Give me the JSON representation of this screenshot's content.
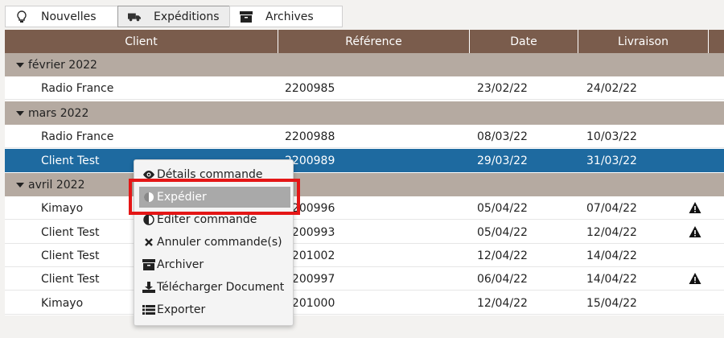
{
  "tabs": [
    {
      "label": "Nouvelles",
      "icon": "lightbulb-icon"
    },
    {
      "label": "Expéditions",
      "icon": "truck-icon",
      "active": true
    },
    {
      "label": "Archives",
      "icon": "archive-box-icon"
    }
  ],
  "table": {
    "columns": [
      "Client",
      "Référence",
      "Date",
      "Livraison",
      ""
    ],
    "groups": [
      {
        "label": "février 2022",
        "rows": [
          {
            "client": "Radio France",
            "ref": "2200985",
            "date": "23/02/22",
            "livraison": "24/02/22",
            "warning": false
          }
        ]
      },
      {
        "label": "mars 2022",
        "rows": [
          {
            "client": "Radio France",
            "ref": "2200988",
            "date": "08/03/22",
            "livraison": "10/03/22",
            "warning": false
          },
          {
            "client": "Client Test",
            "ref": "2200989",
            "date": "29/03/22",
            "livraison": "31/03/22",
            "warning": false,
            "selected": true
          }
        ]
      },
      {
        "label": "avril 2022",
        "rows": [
          {
            "client": "Kimayo",
            "ref": "2200996",
            "date": "05/04/22",
            "livraison": "07/04/22",
            "warning": true
          },
          {
            "client": "Client Test",
            "ref": "2200993",
            "date": "05/04/22",
            "livraison": "12/04/22",
            "warning": true
          },
          {
            "client": "Client Test",
            "ref": "2201002",
            "date": "12/04/22",
            "livraison": "14/04/22",
            "warning": false
          },
          {
            "client": "Client Test",
            "ref": "2200997",
            "date": "06/04/22",
            "livraison": "14/04/22",
            "warning": true
          },
          {
            "client": "Kimayo",
            "ref": "2201000",
            "date": "12/04/22",
            "livraison": "15/04/22",
            "warning": false
          }
        ]
      }
    ]
  },
  "context_menu": {
    "items": [
      {
        "label": "Détails commande",
        "icon": "eye-icon"
      },
      {
        "label": "Expédier",
        "icon": "half-circle-icon",
        "active": true
      },
      {
        "label": "Editer commande",
        "icon": "half-circle-icon"
      },
      {
        "label": "Annuler commande(s)",
        "icon": "close-icon"
      },
      {
        "label": "Archiver",
        "icon": "archive-box-icon"
      },
      {
        "label": "Télécharger Document",
        "icon": "download-icon"
      },
      {
        "label": "Exporter",
        "icon": "list-icon"
      }
    ]
  },
  "colors": {
    "header": "#7a5c4c",
    "group": "#b5aaa1",
    "selected": "#1e6aa0",
    "highlight": "#e41616"
  }
}
